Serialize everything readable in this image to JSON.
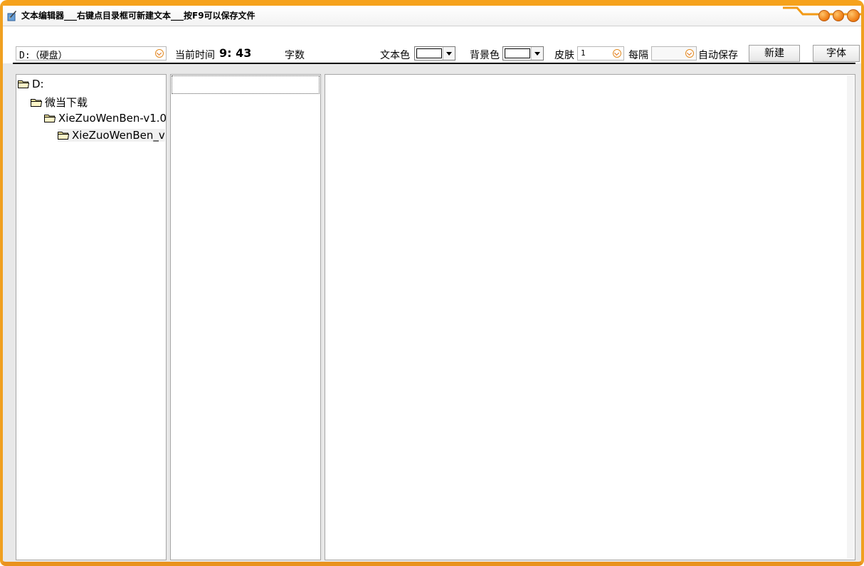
{
  "window": {
    "title": "文本编辑器___右键点目录框可新建文本___按F9可以保存文件",
    "accent_color": "#f6a21c"
  },
  "toolbar": {
    "drive_combo_value": "D:（硬盘）",
    "time_label": "当前时间",
    "time_value": "9: 43",
    "word_count_label": "字数",
    "text_color_label": "文本色",
    "bg_color_label": "背景色",
    "skin_label": "皮肤",
    "skin_value": "1",
    "interval_label": "每隔",
    "interval_value": "",
    "autosave_label": "自动保存",
    "new_button": "新建",
    "font_button": "字体"
  },
  "tree": {
    "items": [
      {
        "label": "D:"
      },
      {
        "label": "微当下载"
      },
      {
        "label": "XieZuoWenBen-v1.0"
      },
      {
        "label": "XieZuoWenBen_v"
      }
    ]
  },
  "icons": {
    "app": "app-icon",
    "folder": "folder-icon",
    "dropdown": "chevron-down-icon"
  }
}
